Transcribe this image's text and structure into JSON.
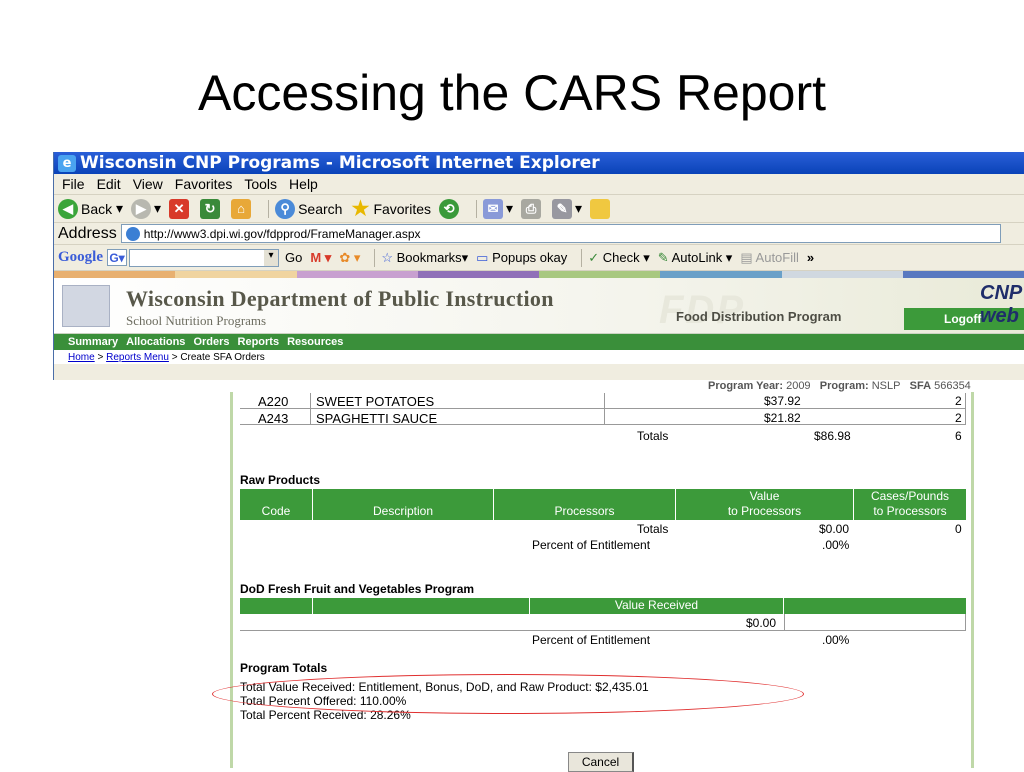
{
  "slide_title": "Accessing the CARS Report",
  "window": {
    "title": "Wisconsin CNP Programs - Microsoft Internet Explorer",
    "menu": [
      "File",
      "Edit",
      "View",
      "Favorites",
      "Tools",
      "Help"
    ],
    "toolbar": {
      "back": "Back",
      "search": "Search",
      "favorites": "Favorites"
    },
    "address_label": "Address",
    "address_url": "http://www3.dpi.wi.gov/fdpprod/FrameManager.aspx",
    "googlebar": {
      "logo": "Google",
      "g_button": "G▾",
      "go": "Go",
      "bookmarks": "Bookmarks▾",
      "popups": "Popups okay",
      "check": "Check ▾",
      "autolink": "AutoLink ▾",
      "autofill": "AutoFill",
      "more": "»"
    }
  },
  "site": {
    "title": "Wisconsin Department of Public Instruction",
    "subtitle": "School Nutrition Programs",
    "fdp_watermark": "FDP",
    "fdp_label": "Food Distribution Program",
    "logoff": "Logoff",
    "cnp_logo": "CNP web",
    "nav": [
      "Summary",
      "Allocations",
      "Orders",
      "Reports",
      "Resources"
    ],
    "breadcrumb": {
      "home": "Home",
      "sep1": ">",
      "reports_menu": "Reports Menu",
      "sep2": ">",
      "current": "Create SFA Orders"
    }
  },
  "program_line": {
    "year_label": "Program Year:",
    "year": "2009",
    "program_label": "Program:",
    "program": "NSLP",
    "sfa_label": "SFA",
    "sfa": "566354"
  },
  "commodities": [
    {
      "code": "A220",
      "description": "SWEET POTATOES",
      "value": "$37.92",
      "cases": "2"
    },
    {
      "code": "A243",
      "description": "SPAGHETTI SAUCE",
      "value": "$21.82",
      "cases": "2"
    }
  ],
  "commodity_totals": {
    "label": "Totals",
    "value": "$86.98",
    "cases": "6"
  },
  "raw_products": {
    "title": "Raw Products",
    "headers": {
      "code": "Code",
      "description": "Description",
      "processors": "Processors",
      "value_line1": "Value",
      "value_line2": "to Processors",
      "cases_line1": "Cases/Pounds",
      "cases_line2": "to Processors"
    },
    "totals_label": "Totals",
    "totals_value": "$0.00",
    "totals_cases": "0",
    "percent_label": "Percent of Entitlement",
    "percent_value": ".00%"
  },
  "dod": {
    "title": "DoD Fresh Fruit and Vegetables Program",
    "header": "Value Received",
    "value": "$0.00",
    "percent_label": "Percent of Entitlement",
    "percent_value": ".00%"
  },
  "program_totals": {
    "title": "Program Totals",
    "line1": "Total Value Received: Entitlement, Bonus, DoD, and Raw Product: $2,435.01",
    "line2": "Total Percent Offered: 110.00%",
    "line3": "Total Percent Received: 28.26%"
  },
  "cancel": "Cancel",
  "colors": {
    "titlebar": "#0a43b8",
    "green": "#3c9a3a",
    "highlight_oval": "#e03030"
  }
}
